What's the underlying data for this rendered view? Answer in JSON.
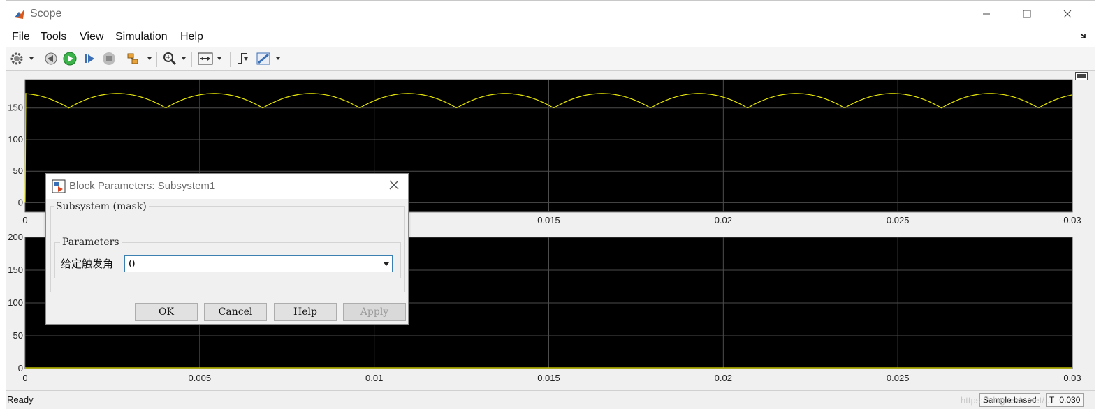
{
  "window": {
    "title": "Scope",
    "controls": {
      "minimize": "—",
      "maximize": "☐",
      "close": "✕"
    }
  },
  "menu": [
    "File",
    "Tools",
    "View",
    "Simulation",
    "Help"
  ],
  "toolbar": {
    "icons": [
      "gear-icon",
      "stepback-icon",
      "run-icon",
      "stepforward-icon",
      "stop-icon",
      "highlight-icon",
      "zoom-icon",
      "autoscale-icon",
      "triggers-icon",
      "measure-icon"
    ]
  },
  "chart_data": [
    {
      "type": "line",
      "title": "",
      "xlabel": "",
      "ylabel": "",
      "xlim": [
        0,
        0.03
      ],
      "ylim": [
        -15,
        195
      ],
      "x_ticks": [
        "0",
        "0.005",
        "0.01",
        "0.015",
        "0.02",
        "0.025",
        "0.03"
      ],
      "y_ticks": [
        "0",
        "50",
        "100",
        "150"
      ],
      "grid": true,
      "series": [
        {
          "color": "#e6e600",
          "description": "six-pulse rectified voltage ripple",
          "x": [
            0,
            0.0001,
            0.00167,
            0.00417,
            0.00667,
            0.00917,
            0.01167,
            0.01417,
            0.01667,
            0.01917,
            0.02167,
            0.02417,
            0.02667,
            0.02917,
            0.03
          ],
          "y_peaks_valleys": {
            "peak": 173,
            "valley": 150,
            "period": 0.002778,
            "first_valley": 0.00125
          }
        }
      ]
    },
    {
      "type": "line",
      "title": "",
      "xlabel": "",
      "ylabel": "",
      "xlim": [
        0,
        0.03
      ],
      "ylim": [
        0,
        200
      ],
      "x_ticks": [
        "0",
        "0.005",
        "0.01",
        "0.015",
        "0.02",
        "0.025",
        "0.03"
      ],
      "y_ticks": [
        "0",
        "50",
        "100",
        "150",
        "200"
      ],
      "grid": true,
      "series": [
        {
          "color": "#e6e600",
          "x": [
            0,
            0.03
          ],
          "y": [
            0,
            0
          ]
        }
      ]
    }
  ],
  "dialog": {
    "title": "Block Parameters: Subsystem1",
    "section": "Subsystem (mask)",
    "group": "Parameters",
    "param_label": "给定触发角",
    "param_value": "0",
    "buttons": {
      "ok": "OK",
      "cancel": "Cancel",
      "help": "Help",
      "apply": "Apply"
    }
  },
  "status": {
    "text": "Ready",
    "mode": "Sample based",
    "time": "T=0.030",
    "watermark": "https://blog.csdn.net/..."
  }
}
